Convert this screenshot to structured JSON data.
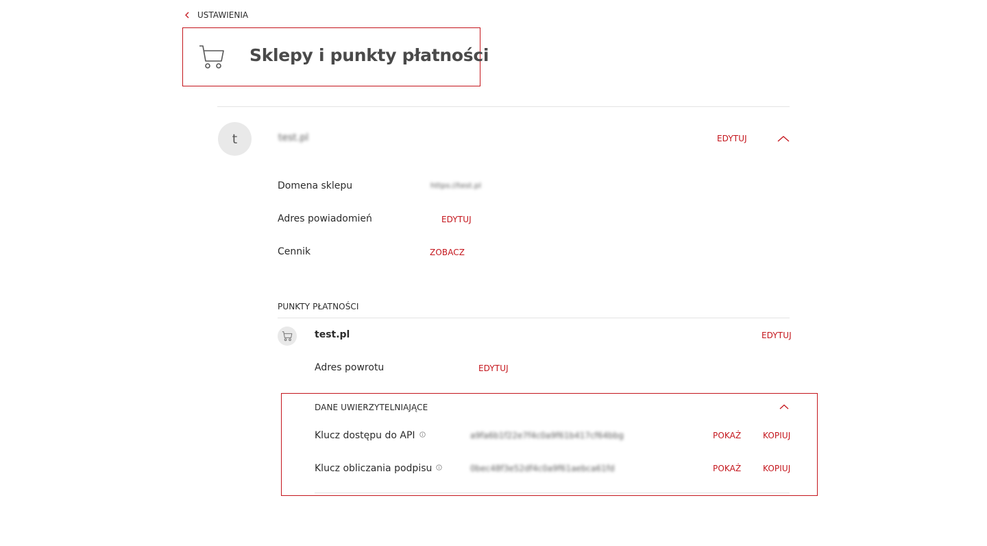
{
  "breadcrumb": {
    "back_label": "USTAWIENIA"
  },
  "page": {
    "title": "Sklepy i punkty płatności"
  },
  "shop": {
    "avatar_letter": "t",
    "name": "test.pl",
    "edit_label": "EDYTUJ",
    "details": {
      "domain_label": "Domena sklepu",
      "domain_value": "https://test.pl",
      "notifications_label": "Adres powiadomień",
      "notifications_action": "EDYTUJ",
      "pricing_label": "Cennik",
      "pricing_action": "ZOBACZ"
    }
  },
  "payment_points": {
    "section_title": "PUNKTY PŁATNOŚCI",
    "point": {
      "name": "test.pl",
      "edit_label": "EDYTUJ",
      "return_label": "Adres powrotu",
      "return_action": "EDYTUJ"
    }
  },
  "credentials": {
    "section_title": "DANE UWIERZYTELNIAJĄCE",
    "api_key": {
      "label": "Klucz dostępu do API",
      "value": "a9fa6b1f22e7f4c0a9f61b417cf64bbg",
      "show_label": "POKAŻ",
      "copy_label": "KOPIUJ"
    },
    "signature_key": {
      "label": "Klucz obliczania podpisu",
      "value": "0bec48f3e52df4c0a9f61aebca61fd",
      "show_label": "POKAŻ",
      "copy_label": "KOPIUJ"
    }
  },
  "colors": {
    "accent": "#c4151c",
    "divider": "#e3e3e3",
    "avatar_bg": "#e9e9e9"
  }
}
